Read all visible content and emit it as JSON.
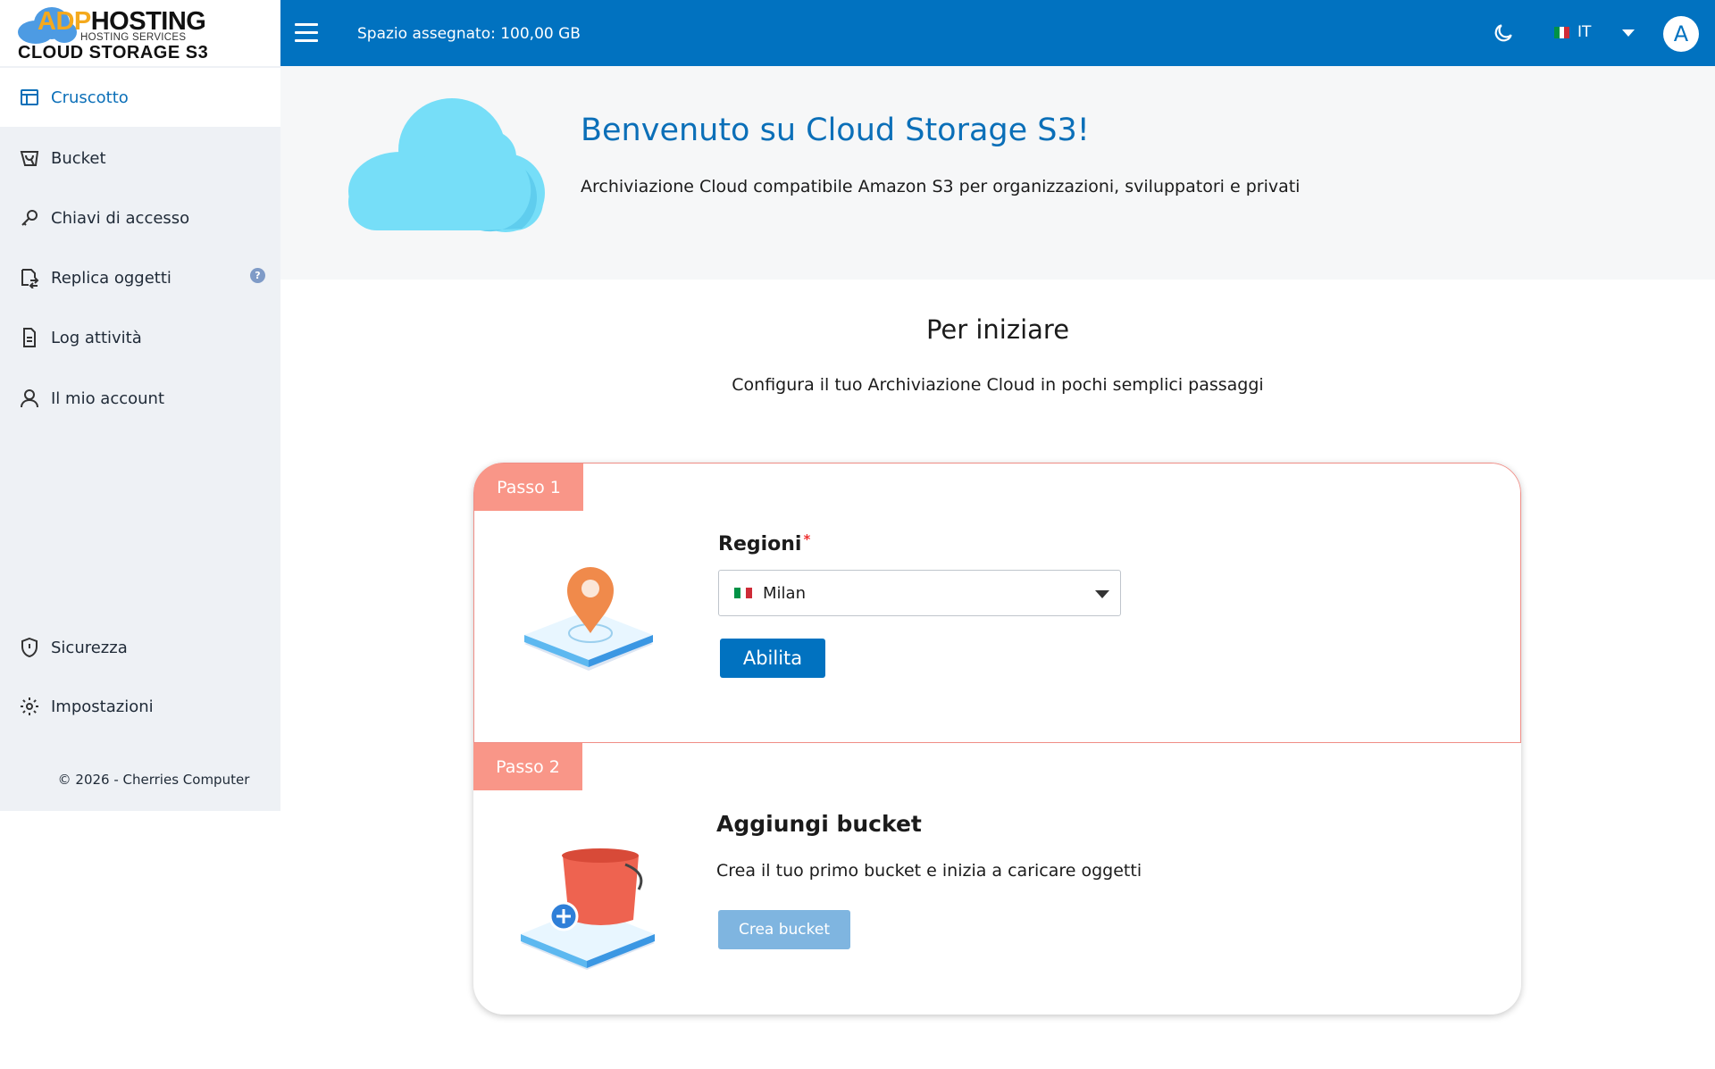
{
  "brand": {
    "logo_adp": "ADP",
    "logo_hosting": "HOSTING",
    "logo_sub": "HOSTING SERVICES",
    "logo_main": "CLOUD STORAGE S3"
  },
  "sidebar": {
    "items": [
      {
        "label": "Cruscotto",
        "icon": "dashboard-icon",
        "active": true
      },
      {
        "label": "Bucket",
        "icon": "bucket-icon"
      },
      {
        "label": "Chiavi di accesso",
        "icon": "key-icon"
      },
      {
        "label": "Replica oggetti",
        "icon": "replicate-icon",
        "badge": "?"
      },
      {
        "label": "Log attività",
        "icon": "document-icon"
      },
      {
        "label": "Il mio account",
        "icon": "user-icon"
      }
    ],
    "bottom_items": [
      {
        "label": "Sicurezza",
        "icon": "shield-icon"
      },
      {
        "label": "Impostazioni",
        "icon": "gear-icon"
      }
    ],
    "copyright": "© 2026 - Cherries Computer"
  },
  "topbar": {
    "space_label": "Spazio assegnato: 100,00 GB",
    "language": "IT",
    "avatar_initial": "A"
  },
  "hero": {
    "title": "Benvenuto su Cloud Storage S3!",
    "subtitle": "Archiviazione Cloud compatibile Amazon S3 per organizzazioni, sviluppatori e privati"
  },
  "getting_started": {
    "title": "Per iniziare",
    "subtitle": "Configura il tuo Archiviazione Cloud in pochi semplici passaggi"
  },
  "step1": {
    "tag": "Passo 1",
    "label": "Regioni",
    "required_mark": "*",
    "selected_region": "Milan",
    "button": "Abilita"
  },
  "step2": {
    "tag": "Passo 2",
    "title": "Aggiungi bucket",
    "subtitle": "Crea il tuo primo bucket e inizia a caricare oggetti",
    "button": "Crea bucket"
  },
  "colors": {
    "primary": "#0172c0",
    "step_tag": "#f99688",
    "step_border": "#f08d86",
    "sidebar_bg": "#eef1f5",
    "disabled_button": "#7fb5e0"
  }
}
